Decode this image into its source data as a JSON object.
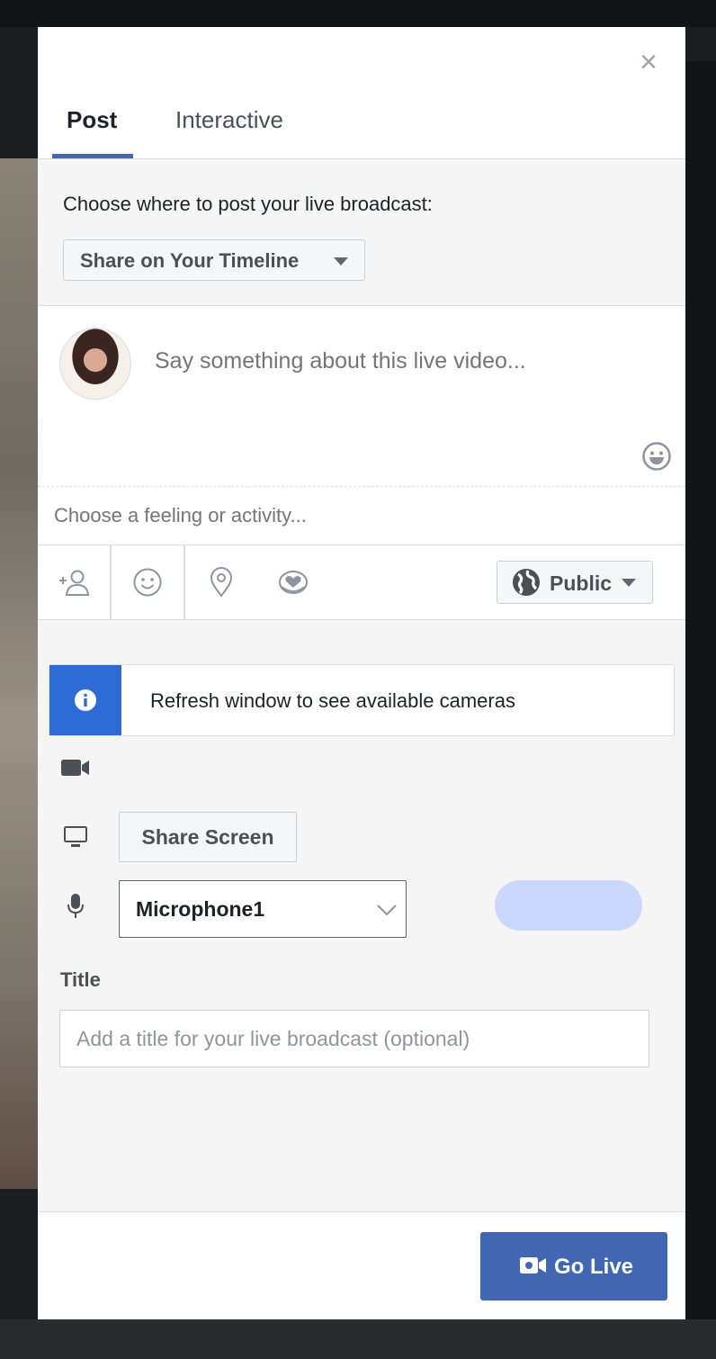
{
  "dialog": {
    "close_symbol": "×",
    "tabs": [
      {
        "label": "Post",
        "active": true
      },
      {
        "label": "Interactive",
        "active": false
      }
    ],
    "prompt": "Choose where to post your live broadcast:",
    "share_dropdown": "Share on Your Timeline",
    "compose_placeholder": "Say something about this live video...",
    "feeling_placeholder": "Choose a feeling or activity...",
    "actions": [
      "tag-friends-icon",
      "feeling-icon",
      "location-icon",
      "support-nonprofit-icon"
    ],
    "audience": "Public",
    "info_message": "Refresh window to see available cameras",
    "share_screen": "Share Screen",
    "microphone": "Microphone1",
    "title_label": "Title",
    "title_placeholder": "Add a title for your live broadcast (optional)",
    "go_live": "Go Live"
  },
  "colors": {
    "accent": "#4267b2",
    "info": "#2d6cd6",
    "mic_level": "#cad9fb"
  }
}
